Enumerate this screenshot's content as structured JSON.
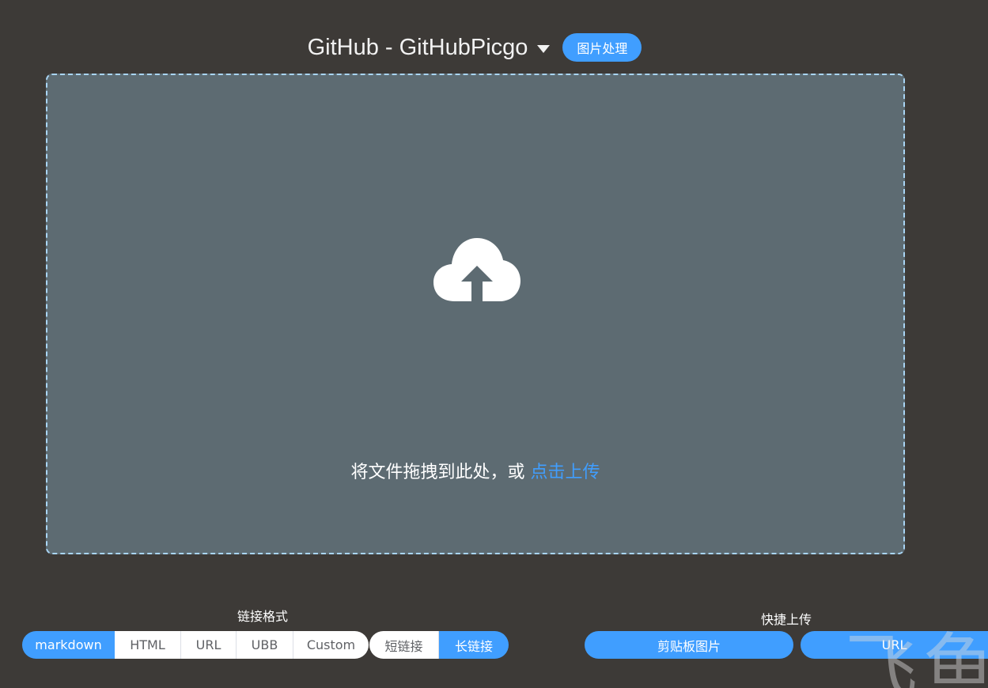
{
  "header": {
    "title": "GitHub - GitHubPicgo",
    "image_process_label": "图片处理"
  },
  "upload": {
    "icon": "cloud-upload-icon",
    "drop_text": "将文件拖拽到此处，或 ",
    "click_upload": "点击上传"
  },
  "link_format": {
    "label": "链接格式",
    "options": [
      "markdown",
      "HTML",
      "URL",
      "UBB",
      "Custom"
    ],
    "selected": "markdown"
  },
  "link_length": {
    "options": [
      "短链接",
      "长链接"
    ],
    "selected": "长链接"
  },
  "quick_upload": {
    "label": "快捷上传",
    "clipboard_label": "剪贴板图片",
    "url_label": "URL"
  },
  "watermark": "飞鱼",
  "colors": {
    "accent": "#409eff",
    "background": "#3d3a37",
    "dropzone": "#5d6b72",
    "dropzone_border": "#a9d5f5"
  }
}
